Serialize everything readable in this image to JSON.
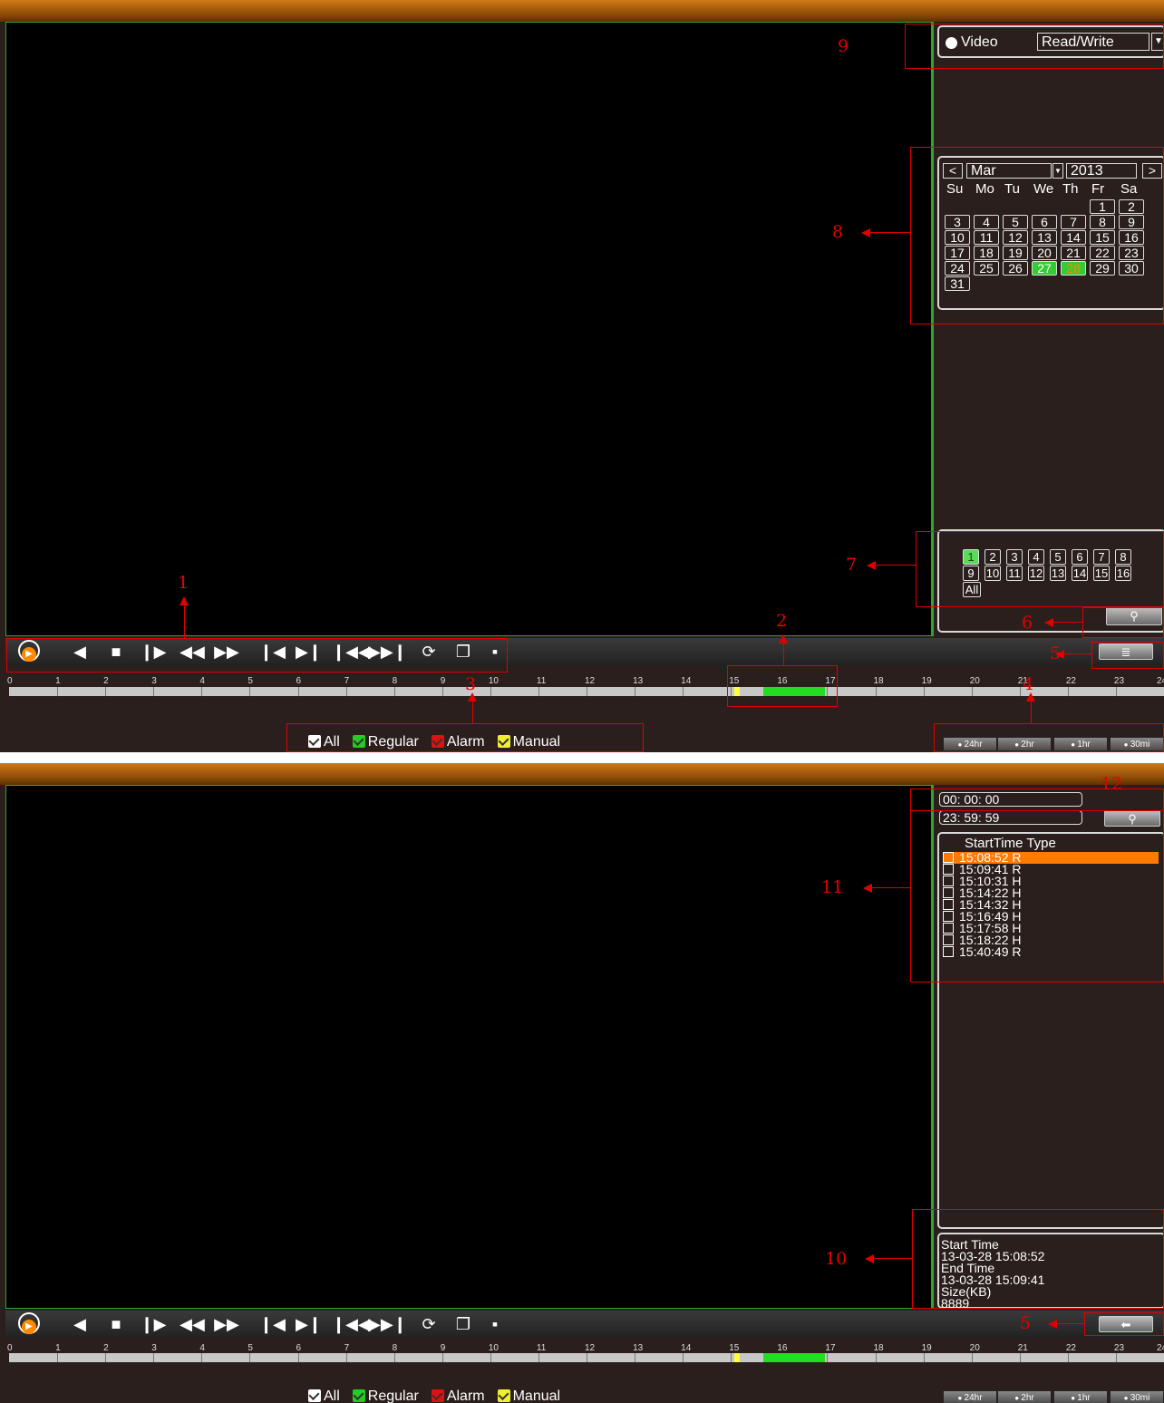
{
  "screen1": {
    "annotations": [
      "1",
      "2",
      "3",
      "4",
      "5",
      "6",
      "7",
      "8",
      "9"
    ],
    "top_panel": {
      "radio_label": "Video",
      "mode_value": "Read/Write"
    },
    "calendar": {
      "prev": "<",
      "next": ">",
      "month": "Mar",
      "year": "2013",
      "weekdays": [
        "Su",
        "Mo",
        "Tu",
        "We",
        "Th",
        "Fr",
        "Sa"
      ],
      "days": [
        "1",
        "2",
        "3",
        "4",
        "5",
        "6",
        "7",
        "8",
        "9",
        "10",
        "11",
        "12",
        "13",
        "14",
        "15",
        "16",
        "17",
        "18",
        "19",
        "20",
        "21",
        "22",
        "23",
        "24",
        "25",
        "26",
        "27",
        "28",
        "29",
        "30",
        "31"
      ],
      "first_weekday_index": 5,
      "highlight_green": "27",
      "highlight_orange": "28"
    },
    "channels": {
      "items": [
        "1",
        "2",
        "3",
        "4",
        "5",
        "6",
        "7",
        "8",
        "9",
        "10",
        "11",
        "12",
        "13",
        "14",
        "15",
        "16"
      ],
      "all_label": "All",
      "selected": "1"
    }
  },
  "screen2": {
    "annotations": [
      "5",
      "10",
      "11",
      "12"
    ],
    "search": {
      "start": "00: 00: 00",
      "end": "23: 59: 59"
    },
    "file_list": {
      "header": "StartTime Type",
      "rows": [
        {
          "time": "15:08:52",
          "type": "R"
        },
        {
          "time": "15:09:41",
          "type": "R"
        },
        {
          "time": "15:10:31",
          "type": "H"
        },
        {
          "time": "15:14:22",
          "type": "H"
        },
        {
          "time": "15:14:32",
          "type": "H"
        },
        {
          "time": "15:16:49",
          "type": "H"
        },
        {
          "time": "15:17:58",
          "type": "H"
        },
        {
          "time": "15:18:22",
          "type": "H"
        },
        {
          "time": "15:40:49",
          "type": "R"
        }
      ]
    },
    "file_info": {
      "start_label": "Start Time",
      "start_value": "13-03-28 15:08:52",
      "end_label": "End Time",
      "end_value": "13-03-28 15:09:41",
      "size_label": "Size(KB)",
      "size_value": "8889"
    }
  },
  "timeline": {
    "hours": [
      "0",
      "1",
      "2",
      "3",
      "4",
      "5",
      "6",
      "7",
      "8",
      "9",
      "10",
      "11",
      "12",
      "13",
      "14",
      "15",
      "16",
      "17",
      "18",
      "19",
      "20",
      "21",
      "22",
      "23",
      "24"
    ],
    "segments": [
      {
        "start_hour": 15.08,
        "end_hour": 15.18,
        "color": "#ffff40"
      },
      {
        "start_hour": 15.18,
        "end_hour": 15.33,
        "color": "#c8c8c8"
      },
      {
        "start_hour": 15.68,
        "end_hour": 16.95,
        "color": "#22dd22"
      }
    ]
  },
  "legend": {
    "all": "All",
    "regular": "Regular",
    "alarm": "Alarm",
    "manual": "Manual",
    "colors": {
      "all": "#ffffff",
      "regular": "#22cc22",
      "alarm": "#dd1111",
      "manual": "#eeee33"
    }
  },
  "zoom": [
    "24hr",
    "2hr",
    "1hr",
    "30mi"
  ],
  "controls": [
    "play-icon",
    "reverse-icon",
    "stop-icon",
    "slow-play-icon",
    "rewind-icon",
    "fast-forward-icon",
    "previous-frame-icon",
    "next-frame-icon",
    "previous-file-icon",
    "next-file-icon",
    "loop-icon",
    "window-icon",
    "square-icon"
  ]
}
